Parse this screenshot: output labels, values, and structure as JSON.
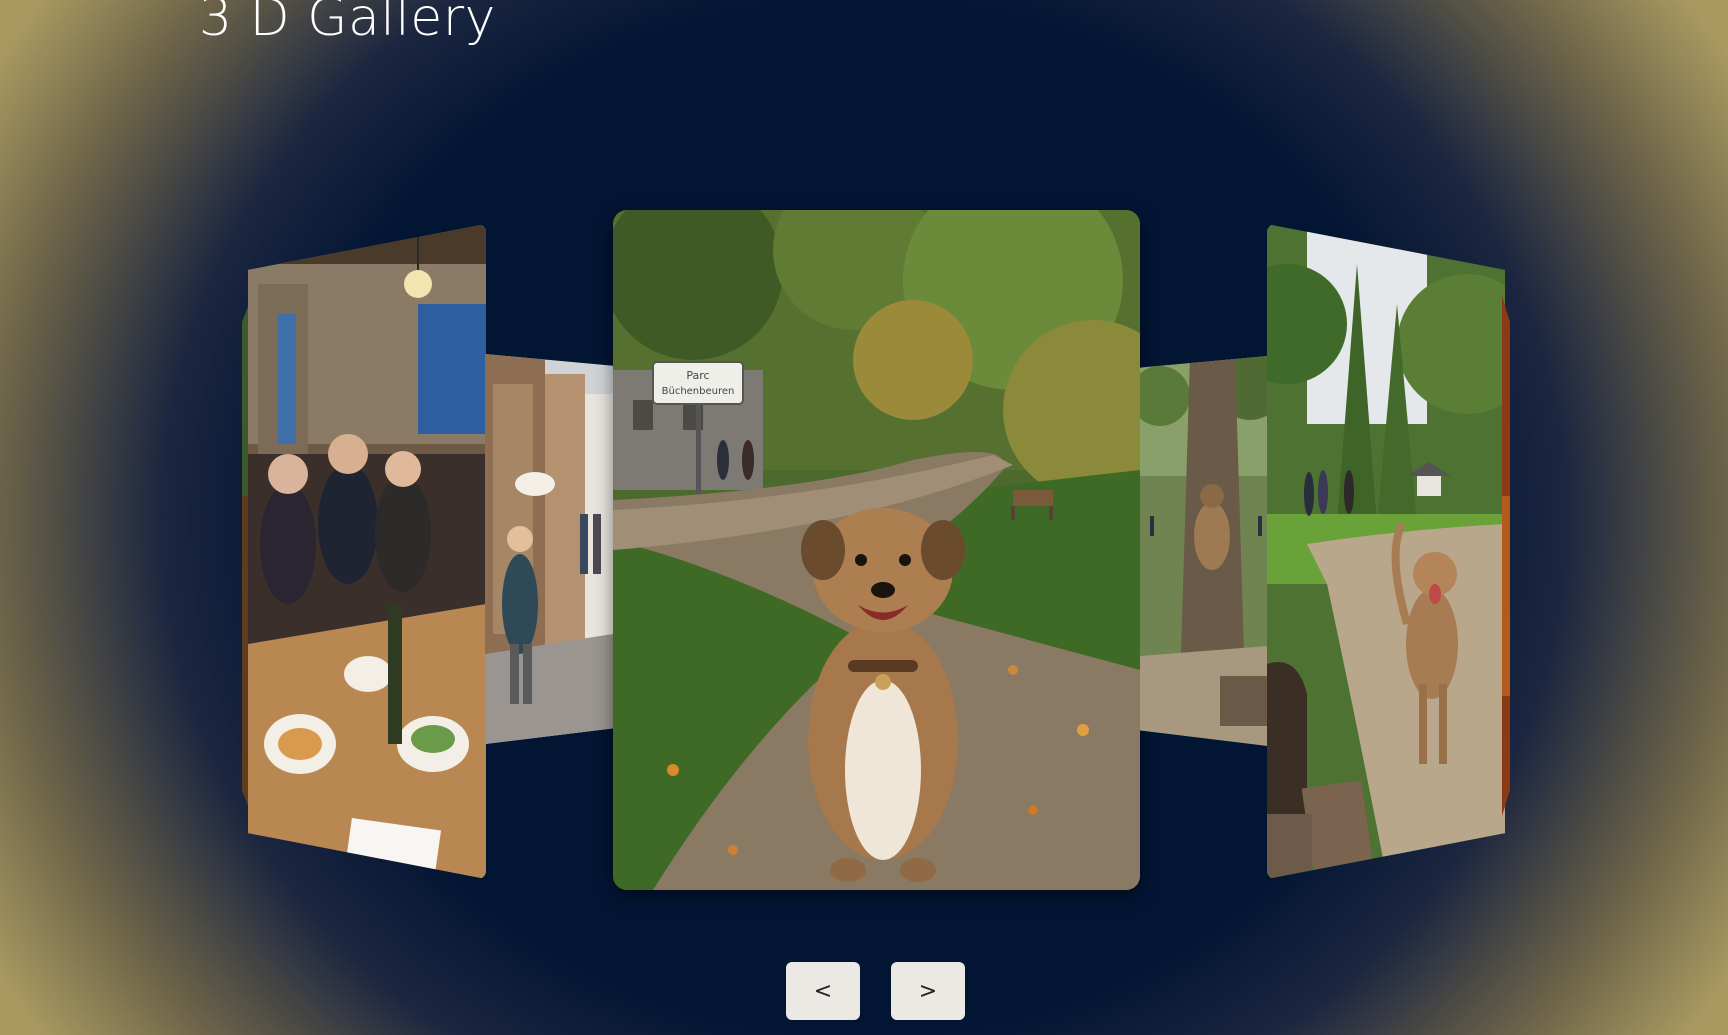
{
  "page": {
    "title": "3 D Gallery"
  },
  "gallery": {
    "images": [
      {
        "icon": "food-photo",
        "sign_text": ""
      },
      {
        "icon": "restaurant-dinner-photo",
        "sign_text": ""
      },
      {
        "icon": "village-street-photo",
        "sign_text": ""
      },
      {
        "icon": "park-dog-photo",
        "sign_text": "Parc Büchenbeuren"
      },
      {
        "icon": "tree-monkey-photo",
        "sign_text": ""
      },
      {
        "icon": "park-path-dog-photo",
        "sign_text": ""
      },
      {
        "icon": "autumn-photo",
        "sign_text": ""
      }
    ]
  },
  "controls": {
    "prev_label": "<",
    "next_label": ">"
  },
  "colors": {
    "background_center": "#021533",
    "background_edge": "#a99960",
    "button_bg": "#ece8e3"
  }
}
